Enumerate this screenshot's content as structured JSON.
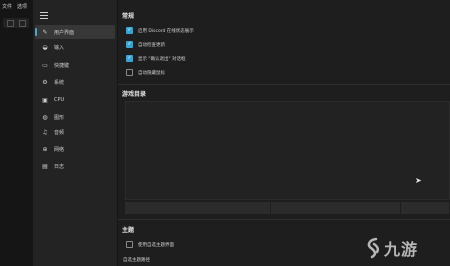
{
  "menubar": {
    "items": [
      "文件",
      "选项"
    ]
  },
  "nav": {
    "items": [
      {
        "label": "用户界面",
        "icon": "pen-icon",
        "glyph": "✎",
        "active": true
      },
      {
        "label": "输入",
        "icon": "gamepad-icon",
        "glyph": "◒",
        "active": false
      },
      {
        "label": "快捷键",
        "icon": "keyboard-icon",
        "glyph": "▭",
        "active": false
      },
      {
        "label": "系统",
        "icon": "gear-icon",
        "glyph": "⚙",
        "active": false
      },
      {
        "label": "CPU",
        "icon": "cpu-icon",
        "glyph": "▣",
        "active": false
      },
      {
        "label": "图形",
        "icon": "palette-icon",
        "glyph": "◍",
        "active": false
      },
      {
        "label": "音频",
        "icon": "music-icon",
        "glyph": "♫",
        "active": false
      },
      {
        "label": "网络",
        "icon": "globe-icon",
        "glyph": "⊕",
        "active": false
      },
      {
        "label": "日志",
        "icon": "log-icon",
        "glyph": "▤",
        "active": false
      }
    ]
  },
  "general": {
    "title": "常规",
    "options": [
      {
        "label": "启用 Discord 在线状态展示",
        "checked": true
      },
      {
        "label": "自动检查更新",
        "checked": true
      },
      {
        "label": "显示 \"确认退出\" 对话框",
        "checked": true
      },
      {
        "label": "自动隐藏鼠标",
        "checked": false
      }
    ]
  },
  "game_dirs": {
    "title": "游戏目录"
  },
  "theme": {
    "title": "主题",
    "option": {
      "label": "使用自选主题界面",
      "checked": false
    },
    "path_label": "自选主题路径"
  },
  "watermark": {
    "text": "九游"
  },
  "colors": {
    "accent": "#36a6d9",
    "active_nav": "#373737"
  }
}
